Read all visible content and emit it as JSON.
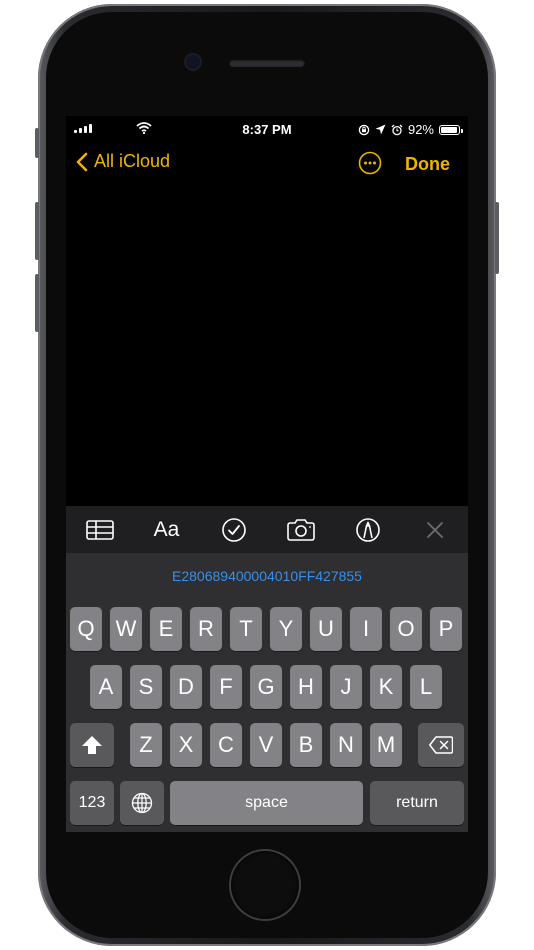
{
  "status_bar": {
    "time": "8:37 PM",
    "battery_percent": "92%",
    "battery_level": 0.92,
    "icons": [
      "cellular-signal-icon",
      "wifi-icon",
      "rotation-lock-icon",
      "location-arrow-icon",
      "alarm-clock-icon",
      "battery-icon"
    ]
  },
  "nav": {
    "back_label": "All iCloud",
    "done_label": "Done",
    "accent_color": "#f0b400"
  },
  "toolbar": {
    "items": [
      "table-icon",
      "text-format-icon",
      "checklist-icon",
      "camera-icon",
      "markup-pen-icon",
      "close-icon"
    ],
    "format_label": "Aa"
  },
  "predictive": {
    "suggestion": "E280689400004010FF427855"
  },
  "keyboard": {
    "row1": [
      "Q",
      "W",
      "E",
      "R",
      "T",
      "Y",
      "U",
      "I",
      "O",
      "P"
    ],
    "row2": [
      "A",
      "S",
      "D",
      "F",
      "G",
      "H",
      "J",
      "K",
      "L"
    ],
    "row3": [
      "Z",
      "X",
      "C",
      "V",
      "B",
      "N",
      "M"
    ],
    "numbers_label": "123",
    "space_label": "space",
    "return_label": "return",
    "special_icons": [
      "shift-icon",
      "delete-icon",
      "globe-icon"
    ]
  }
}
